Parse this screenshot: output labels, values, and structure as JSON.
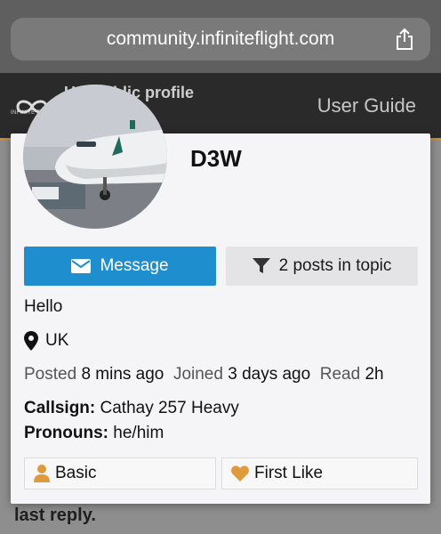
{
  "browser": {
    "url": "community.infiniteflight.com",
    "share_icon": "share-icon"
  },
  "forum_header": {
    "logo_text": "INFINITE FLIGHT",
    "title_behind": "U... public profile",
    "user_guide": "User Guide"
  },
  "behind_content": "last reply.",
  "profile": {
    "username": "D3W",
    "avatar_icon": "avatar-aircraft-photo",
    "actions": {
      "message_label": "Message",
      "posts_label": "2 posts in topic"
    },
    "bio": "Hello",
    "location": "UK",
    "stats": {
      "posted_label": "Posted",
      "posted_value": "8 mins ago",
      "joined_label": "Joined",
      "joined_value": "3 days ago",
      "read_label": "Read",
      "read_value": "2h"
    },
    "fields": {
      "callsign_label": "Callsign:",
      "callsign_value": "Cathay 257 Heavy",
      "pronouns_label": "Pronouns:",
      "pronouns_value": "he/him"
    },
    "badges": [
      {
        "label": "Basic",
        "icon": "person-icon"
      },
      {
        "label": "First Like",
        "icon": "heart-icon"
      }
    ]
  },
  "colors": {
    "accent_blue": "#1f8ecf",
    "badge_orange": "#e09a3e",
    "header_dark": "#2a2a2a"
  }
}
